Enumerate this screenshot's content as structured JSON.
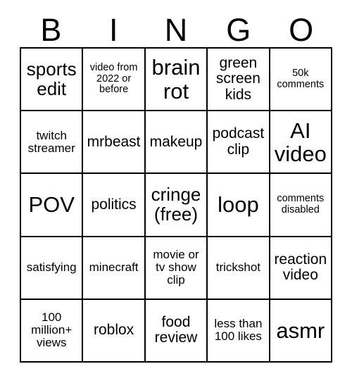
{
  "card": {
    "type": "bingo-card",
    "grid_size": 5,
    "header_letters": [
      "B",
      "I",
      "N",
      "G",
      "O"
    ],
    "colors": {
      "background": "#ffffff",
      "text": "#000000",
      "border": "#000000"
    },
    "rows": [
      [
        {
          "text": "sports edit",
          "size": "lg"
        },
        {
          "text": "video from 2022 or before",
          "size": "xs"
        },
        {
          "text": "brain rot",
          "size": "xl"
        },
        {
          "text": "green screen kids",
          "size": "md"
        },
        {
          "text": "50k comments",
          "size": "xs"
        }
      ],
      [
        {
          "text": "twitch streamer",
          "size": "sm"
        },
        {
          "text": "mrbeast",
          "size": "md"
        },
        {
          "text": "makeup",
          "size": "md"
        },
        {
          "text": "podcast clip",
          "size": "md"
        },
        {
          "text": "AI video",
          "size": "xl"
        }
      ],
      [
        {
          "text": "POV",
          "size": "xl"
        },
        {
          "text": "politics",
          "size": "md"
        },
        {
          "text": "cringe (free)",
          "size": "lg"
        },
        {
          "text": "loop",
          "size": "xl"
        },
        {
          "text": "comments disabled",
          "size": "xs"
        }
      ],
      [
        {
          "text": "satisfying",
          "size": "sm"
        },
        {
          "text": "minecraft",
          "size": "sm"
        },
        {
          "text": "movie or tv show clip",
          "size": "sm"
        },
        {
          "text": "trickshot",
          "size": "sm"
        },
        {
          "text": "reaction video",
          "size": "md"
        }
      ],
      [
        {
          "text": "100 million+ views",
          "size": "sm"
        },
        {
          "text": "roblox",
          "size": "md"
        },
        {
          "text": "food review",
          "size": "md"
        },
        {
          "text": "less than 100 likes",
          "size": "sm"
        },
        {
          "text": "asmr",
          "size": "xl"
        }
      ]
    ]
  }
}
